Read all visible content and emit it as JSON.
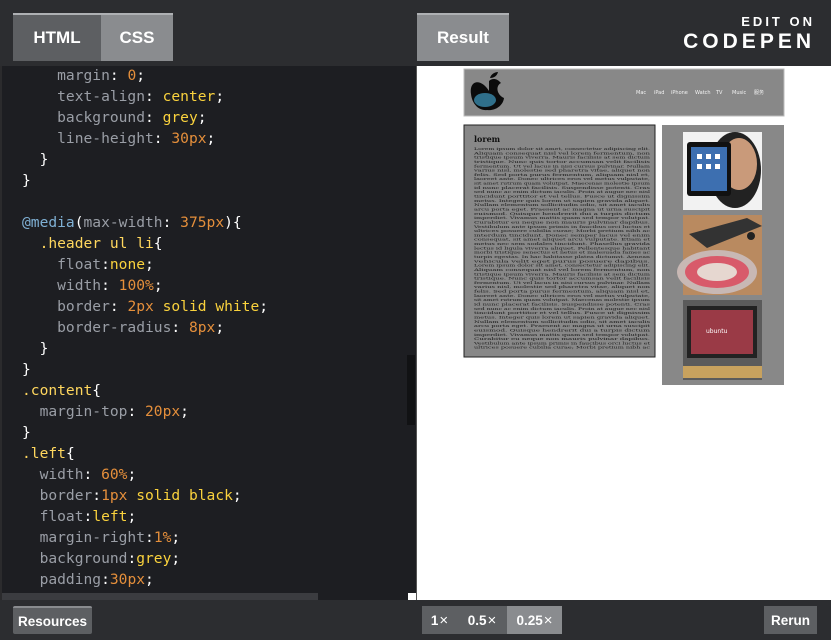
{
  "tabs": {
    "html": "HTML",
    "css": "CSS",
    "result": "Result"
  },
  "brand": {
    "top": "EDIT ON",
    "main": "CODEPEN"
  },
  "colors": {
    "keyword": "#9a9ea6",
    "value": "#fad23d",
    "number": "#e58f3b",
    "selector": "#ffd75e",
    "punct": "#ffffff",
    "at": "#7fb0d4"
  },
  "code": [
    [
      {
        "t": "    margin",
        "c": "keyword"
      },
      {
        "t": ": ",
        "c": "punct"
      },
      {
        "t": "0",
        "c": "number"
      },
      {
        "t": ";",
        "c": "punct"
      }
    ],
    [
      {
        "t": "    text-align",
        "c": "keyword"
      },
      {
        "t": ": ",
        "c": "punct"
      },
      {
        "t": "center",
        "c": "value"
      },
      {
        "t": ";",
        "c": "punct"
      }
    ],
    [
      {
        "t": "    background",
        "c": "keyword"
      },
      {
        "t": ": ",
        "c": "punct"
      },
      {
        "t": "grey",
        "c": "value"
      },
      {
        "t": ";",
        "c": "punct"
      }
    ],
    [
      {
        "t": "    line-height",
        "c": "keyword"
      },
      {
        "t": ": ",
        "c": "punct"
      },
      {
        "t": "30px",
        "c": "number"
      },
      {
        "t": ";",
        "c": "punct"
      }
    ],
    [
      {
        "t": "  }",
        "c": "punct"
      }
    ],
    [
      {
        "t": "}",
        "c": "punct"
      }
    ],
    [
      {
        "t": "",
        "c": "punct"
      }
    ],
    [
      {
        "t": "@media",
        "c": "at"
      },
      {
        "t": "(",
        "c": "punct"
      },
      {
        "t": "max-width",
        "c": "keyword"
      },
      {
        "t": ": ",
        "c": "punct"
      },
      {
        "t": "375px",
        "c": "number"
      },
      {
        "t": "){",
        "c": "punct"
      }
    ],
    [
      {
        "t": "  .header ul li",
        "c": "selector"
      },
      {
        "t": "{",
        "c": "punct"
      }
    ],
    [
      {
        "t": "    float",
        "c": "keyword"
      },
      {
        "t": ":",
        "c": "punct"
      },
      {
        "t": "none",
        "c": "value"
      },
      {
        "t": ";",
        "c": "punct"
      }
    ],
    [
      {
        "t": "    width",
        "c": "keyword"
      },
      {
        "t": ": ",
        "c": "punct"
      },
      {
        "t": "100%",
        "c": "number"
      },
      {
        "t": ";",
        "c": "punct"
      }
    ],
    [
      {
        "t": "    border",
        "c": "keyword"
      },
      {
        "t": ": ",
        "c": "punct"
      },
      {
        "t": "2px",
        "c": "number"
      },
      {
        "t": " solid white",
        "c": "value"
      },
      {
        "t": ";",
        "c": "punct"
      }
    ],
    [
      {
        "t": "    border-radius",
        "c": "keyword"
      },
      {
        "t": ": ",
        "c": "punct"
      },
      {
        "t": "8px",
        "c": "number"
      },
      {
        "t": ";",
        "c": "punct"
      }
    ],
    [
      {
        "t": "  }",
        "c": "punct"
      }
    ],
    [
      {
        "t": "}",
        "c": "punct"
      }
    ],
    [
      {
        "t": ".content",
        "c": "selector"
      },
      {
        "t": "{",
        "c": "punct"
      }
    ],
    [
      {
        "t": "  margin-top",
        "c": "keyword"
      },
      {
        "t": ": ",
        "c": "punct"
      },
      {
        "t": "20px",
        "c": "number"
      },
      {
        "t": ";",
        "c": "punct"
      }
    ],
    [
      {
        "t": "}",
        "c": "punct"
      }
    ],
    [
      {
        "t": ".left",
        "c": "selector"
      },
      {
        "t": "{",
        "c": "punct"
      }
    ],
    [
      {
        "t": "  width",
        "c": "keyword"
      },
      {
        "t": ": ",
        "c": "punct"
      },
      {
        "t": "60%",
        "c": "number"
      },
      {
        "t": ";",
        "c": "punct"
      }
    ],
    [
      {
        "t": "  border",
        "c": "keyword"
      },
      {
        "t": ":",
        "c": "punct"
      },
      {
        "t": "1px",
        "c": "number"
      },
      {
        "t": " solid black",
        "c": "value"
      },
      {
        "t": ";",
        "c": "punct"
      }
    ],
    [
      {
        "t": "  float",
        "c": "keyword"
      },
      {
        "t": ":",
        "c": "punct"
      },
      {
        "t": "left",
        "c": "value"
      },
      {
        "t": ";",
        "c": "punct"
      }
    ],
    [
      {
        "t": "  margin-right",
        "c": "keyword"
      },
      {
        "t": ":",
        "c": "punct"
      },
      {
        "t": "1%",
        "c": "number"
      },
      {
        "t": ";",
        "c": "punct"
      }
    ],
    [
      {
        "t": "  background",
        "c": "keyword"
      },
      {
        "t": ":",
        "c": "punct"
      },
      {
        "t": "grey",
        "c": "value"
      },
      {
        "t": ";",
        "c": "punct"
      }
    ],
    [
      {
        "t": "  padding",
        "c": "keyword"
      },
      {
        "t": ":",
        "c": "punct"
      },
      {
        "t": "30px",
        "c": "number"
      },
      {
        "t": ";",
        "c": "punct"
      }
    ]
  ],
  "preview": {
    "nav": [
      "Mac",
      "iPad",
      "iPhone",
      "Watch",
      "TV",
      "Music",
      "服务"
    ],
    "heading": "lorem",
    "body": "Lorem ipsum dolor sit amet, consectetur adipiscing elit. Aliquam consequat nisl vel lorem fermentum, non tristique ipsum viverra. Mauris facilisis at sem dictum tristique. Nunc quis tortor accumsan velit facilisis fermentum. Ut vel lacus in nisi cursus pulvinar. Nullam varius nisl, molestie sed pharetra vitae, aliquet non felis. Sed porta purus fermentum, aliquam nisl et, laoreet ante. Donec ultrices eros vel metus vulputate, sit amet rutrum quam volutpat. Maecenas molestie ipsum id nunc placerat facilisis. Suspendisse potenti. Cras sed nunc ac enim dictum iaculis. Proin at augue nec nisl tincidunt porttitor et vel tellus. Fusce ut dignissim metus. Integer quis lorem ut sapien gravida aliquet. Nullam elementum sollicitudin odio, sit amet iaculis arcu porta eget. Praesent ac magna ut urna suscipit euismod. Quisque hendrerit dui a turpis dictum imperdiet. Vivamus mattis quam sed tempor volutpat. Curabitur eu neque non mauris pulvinar dapibus. Vestibulum ante ipsum primis in faucibus orci luctus et ultrices posuere cubilia curae; Morbi pretium nibh ac interdum tincidunt. Donec semper lacus vel enim consequat, sit amet aliquet arcu vulputate. Etiam et metus nec sem sodales tincidunt. Phasellus gravida lectus id ligula viverra aliquet. Pellentesque habitant morbi tristique senectus et netus et malesuada fames ac turpis egestas. In hac habitasse platea dictumst. Aenean vehicula velit eget purus posuere dapibus."
  },
  "bottom": {
    "resources": "Resources",
    "zoom_1x": "1",
    "zoom_05x": "0.5",
    "zoom_025x": "0.25",
    "times": "×",
    "rerun": "Rerun"
  }
}
